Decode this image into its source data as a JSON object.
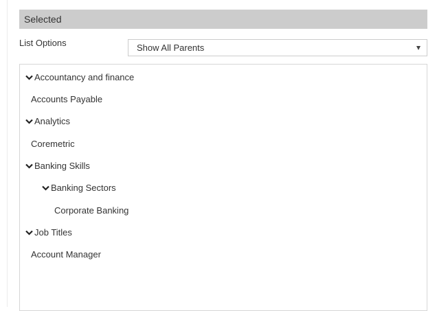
{
  "section": {
    "title": "Selected"
  },
  "list_options": {
    "label": "List Options",
    "selected_value": "Show All Parents"
  },
  "tree": {
    "items": [
      {
        "label": "Accountancy and finance",
        "expandable": true,
        "expanded": true,
        "level": 0
      },
      {
        "label": "Accounts Payable",
        "expandable": false,
        "level": 1
      },
      {
        "label": "Analytics",
        "expandable": true,
        "expanded": true,
        "level": 0
      },
      {
        "label": "Coremetric",
        "expandable": false,
        "level": 1
      },
      {
        "label": "Banking Skills",
        "expandable": true,
        "expanded": true,
        "level": 0
      },
      {
        "label": "Banking Sectors",
        "expandable": true,
        "expanded": true,
        "level": 1
      },
      {
        "label": "Corporate Banking",
        "expandable": false,
        "level": 2
      },
      {
        "label": "Job Titles",
        "expandable": true,
        "expanded": true,
        "level": 0
      },
      {
        "label": "Account Manager",
        "expandable": false,
        "level": 1
      }
    ]
  },
  "colors": {
    "header_bg": "#cccccc",
    "border": "#d6d6d6",
    "text": "#333333"
  },
  "icons": {
    "expanded": "chevron-down-icon",
    "dropdown": "caret-down-icon"
  }
}
